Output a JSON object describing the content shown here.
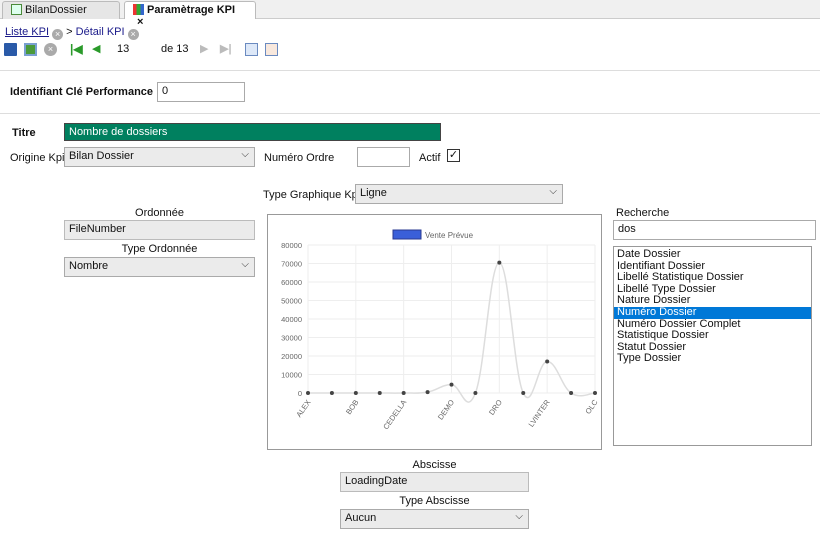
{
  "tabs": [
    {
      "label": "BilanDossier",
      "active": false
    },
    {
      "label": "Paramètrage KPI",
      "active": true,
      "close": "×"
    }
  ],
  "breadcrumb": {
    "list": "Liste KPI",
    "sep": ">",
    "detail": "Détail KPI"
  },
  "toolbar": {
    "current": "13",
    "of": "de 13",
    "icons": [
      "save-icon",
      "refresh-icon",
      "cancel-icon",
      "first-icon",
      "prev-icon",
      "next-icon",
      "last-icon",
      "add-record-icon",
      "delete-record-icon"
    ]
  },
  "form": {
    "id_label": "Identifiant Clé Performance",
    "id_value": "0",
    "titre_label": "Titre",
    "titre_value": "Nombre de dossiers",
    "origine_label": "Origine Kpi",
    "origine_value": "Bilan Dossier",
    "numero_label": "Numéro Ordre",
    "numero_value": "",
    "actif_label": "Actif",
    "actif_checked": true,
    "type_graph_label": "Type Graphique Kpi",
    "type_graph_value": "Ligne",
    "ordonnee_label": "Ordonnée",
    "ordonnee_value": "FileNumber",
    "type_ordonnee_label": "Type Ordonnée",
    "type_ordonnee_value": "Nombre",
    "abscisse_label": "Abscisse",
    "abscisse_value": "LoadingDate",
    "type_abscisse_label": "Type Abscisse",
    "type_abscisse_value": "Aucun",
    "recherche_label": "Recherche",
    "recherche_value": "dos",
    "fields": [
      "Date Dossier",
      "Identifiant Dossier",
      "Libellé Statistique Dossier",
      "Libellé Type Dossier",
      "Nature Dossier",
      "Numéro Dossier",
      "Numéro Dossier Complet",
      "Statistique Dossier",
      "Statut Dossier",
      "Type Dossier"
    ],
    "selected_field": "Numéro Dossier"
  },
  "colors": {
    "title_bg": "#00805f",
    "selected": "#0078d7",
    "legend": "#3a5fd9"
  },
  "chart_data": {
    "type": "line",
    "categories": [
      "ALEX",
      "",
      "BOB",
      "",
      "CEDELLA",
      "",
      "DEMO",
      "",
      "DRO",
      "",
      "LVINTER",
      "",
      "OLC"
    ],
    "series": [
      {
        "name": "Vente Prévue",
        "values": [
          0,
          0,
          0,
          0,
          0,
          500,
          4500,
          0,
          70500,
          0,
          17000,
          0,
          0
        ]
      }
    ],
    "ylim": [
      0,
      80000
    ],
    "yticks": [
      "80000",
      "70000",
      "60000",
      "50000",
      "40000",
      "30000",
      "20000",
      "10000",
      "0"
    ],
    "grid": true,
    "legend": "top"
  }
}
